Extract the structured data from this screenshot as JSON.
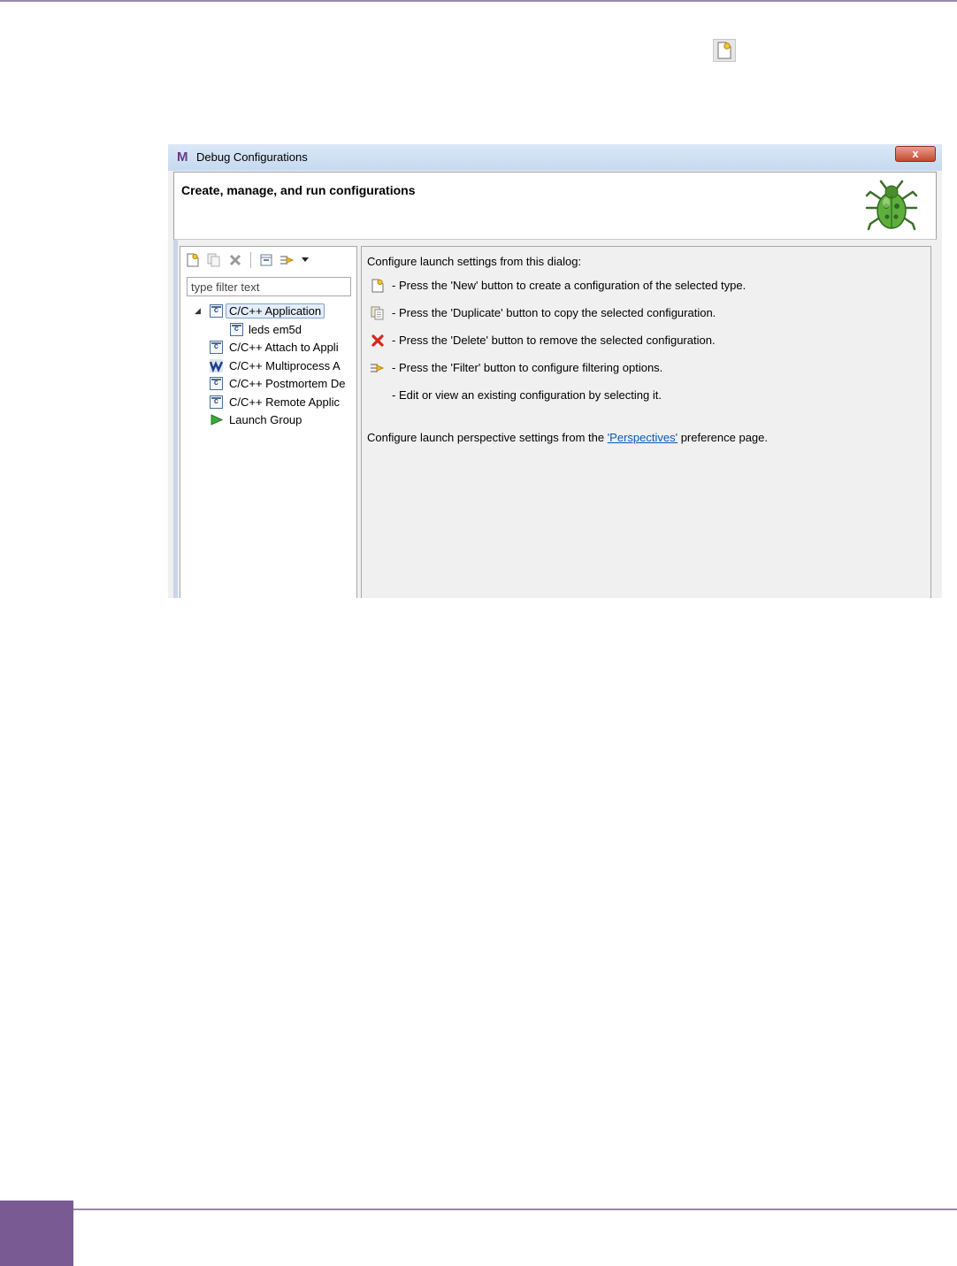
{
  "dialog": {
    "title": "Debug Configurations",
    "app_logo": "M",
    "close_label": "x",
    "heading": "Create, manage, and run configurations"
  },
  "left_pane": {
    "filter_placeholder": "type filter text",
    "tree": [
      {
        "label": "C/C++ Application",
        "icon": "c-application-icon",
        "level": 0,
        "expanded": true,
        "selected": true
      },
      {
        "label": "leds em5d",
        "icon": "c-application-icon",
        "level": 1
      },
      {
        "label": "C/C++ Attach to Appli",
        "icon": "c-application-icon",
        "level": 0
      },
      {
        "label": "C/C++ Multiprocess A",
        "icon": "multiprocess-icon",
        "level": 0
      },
      {
        "label": "C/C++ Postmortem De",
        "icon": "c-application-icon",
        "level": 0
      },
      {
        "label": "C/C++ Remote Applic",
        "icon": "c-application-icon",
        "level": 0
      },
      {
        "label": "Launch Group",
        "icon": "launch-group-icon",
        "level": 0
      }
    ]
  },
  "right_pane": {
    "intro": "Configure launch settings from this dialog:",
    "instructions": [
      {
        "icon": "new-config-icon",
        "text": "- Press the 'New' button to create a configuration of the selected type."
      },
      {
        "icon": "duplicate-icon",
        "text": "- Press the 'Duplicate' button to copy the selected configuration."
      },
      {
        "icon": "delete-icon",
        "text": "- Press the 'Delete' button to remove the selected configuration."
      },
      {
        "icon": "filter-icon",
        "text": "- Press the 'Filter' button to configure filtering options."
      },
      {
        "icon": "",
        "text": "- Edit or view an existing configuration by selecting it."
      }
    ],
    "perspective_prefix": "Configure launch perspective settings from the ",
    "perspective_link": "'Perspectives'",
    "perspective_suffix": " preference page."
  },
  "colors": {
    "accent_purple": "#7a5a92",
    "link": "#0b58b0",
    "delete_red": "#d8261c",
    "launch_green": "#3aa83a"
  }
}
